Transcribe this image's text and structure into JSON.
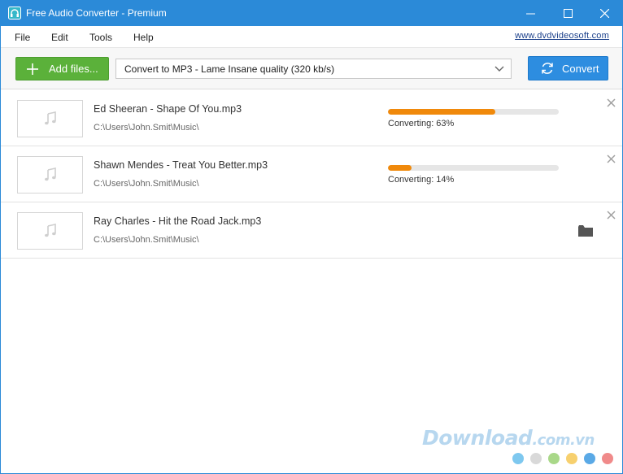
{
  "window": {
    "title": "Free Audio Converter - Premium",
    "accent_color": "#2b8ad8"
  },
  "menu": {
    "items": [
      "File",
      "Edit",
      "Tools",
      "Help"
    ],
    "site_link": "www.dvdvideosoft.com"
  },
  "toolbar": {
    "add_label": "Add files...",
    "format_value": "Convert to MP3 - Lame Insane quality (320 kb/s)",
    "convert_label": "Convert",
    "add_color": "#5bb13a",
    "convert_color": "#2d8de0"
  },
  "files": [
    {
      "name": "Ed Sheeran - Shape Of You.mp3",
      "path": "C:\\Users\\John.Smit\\Music\\",
      "status": "Converting: 63%",
      "progress": 0.63,
      "icon": "music-note-icon"
    },
    {
      "name": "Shawn Mendes - Treat You Better.mp3",
      "path": "C:\\Users\\John.Smit\\Music\\",
      "status": "Converting: 14%",
      "progress": 0.14,
      "icon": "music-note-icon"
    },
    {
      "name": "Ray Charles - Hit the Road Jack.mp3",
      "path": "C:\\Users\\John.Smit\\Music\\",
      "status": "",
      "progress": null,
      "icon": "music-note-icon",
      "action_icon": "folder-icon"
    }
  ],
  "progress_color": "#f0890b",
  "watermark": {
    "main": "Download",
    "suffix": ".com.vn",
    "dot_colors": [
      "#7ec8ef",
      "#d9d9d9",
      "#a9d889",
      "#f7d06e",
      "#5aa9e6",
      "#f08a8a"
    ]
  }
}
